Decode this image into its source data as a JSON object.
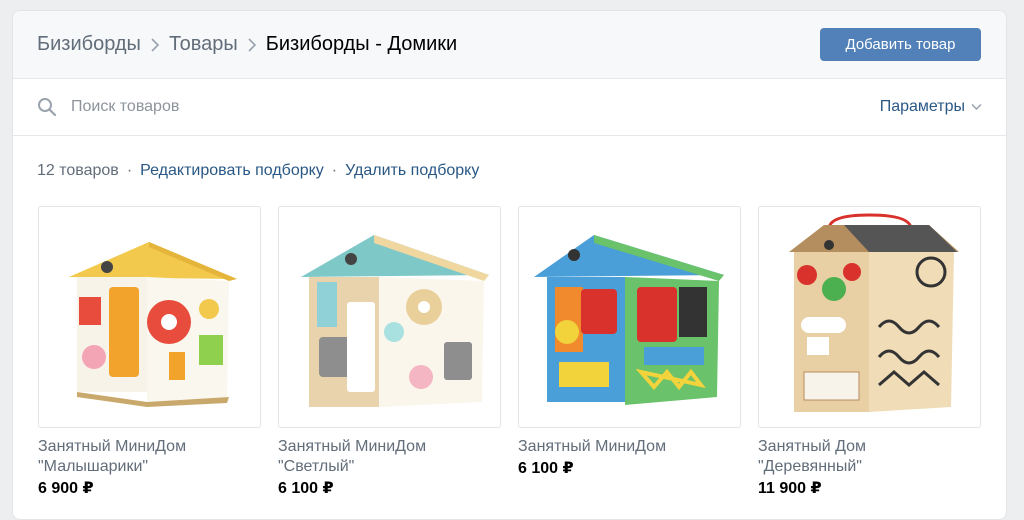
{
  "breadcrumbs": [
    "Бизиборды",
    "Товары",
    "Бизиборды - Домики"
  ],
  "header": {
    "add_button_label": "Добавить товар"
  },
  "search": {
    "placeholder": "Поиск товаров",
    "params_label": "Параметры"
  },
  "collection": {
    "count": "12 товаров",
    "edit_label": "Редактировать подборку",
    "delete_label": "Удалить подборку"
  },
  "products": [
    {
      "name_line1": "Занятный МиниДом",
      "name_line2": "\"Малышарики\"",
      "price": "6 900 ₽",
      "image": "busy-house-yellow"
    },
    {
      "name_line1": "Занятный МиниДом",
      "name_line2": "\"Светлый\"",
      "price": "6 100 ₽",
      "image": "busy-house-light"
    },
    {
      "name_line1": "Занятный МиниДом",
      "name_line2": "",
      "price": "6 100 ₽",
      "image": "busy-house-colorful"
    },
    {
      "name_line1": "Занятный Дом",
      "name_line2": "\"Деревянный\"",
      "price": "11 900 ₽",
      "image": "busy-house-wooden"
    }
  ],
  "colors": {
    "accent": "#5181b8",
    "link": "#2a5885",
    "muted": "#626d7a"
  }
}
